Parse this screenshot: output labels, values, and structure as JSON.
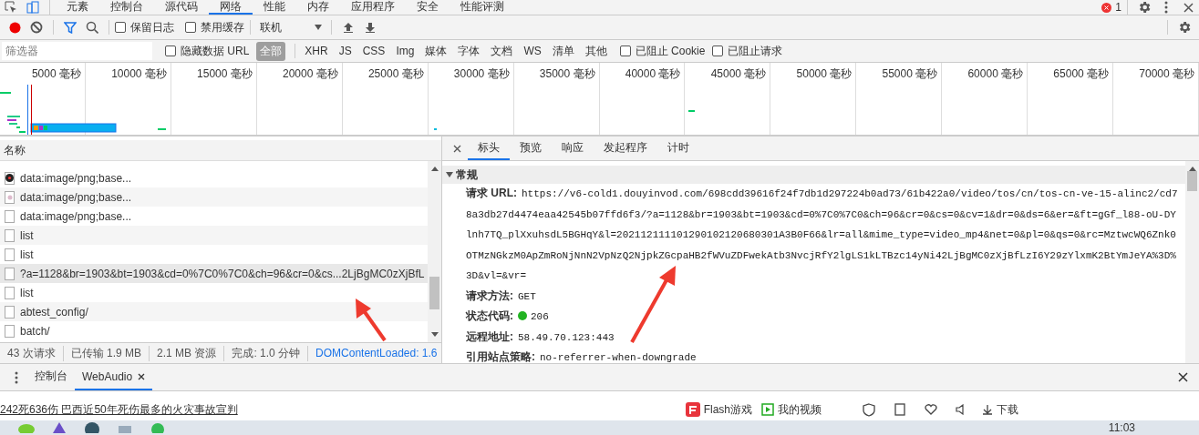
{
  "devtools_tabs": [
    {
      "label": "元素",
      "selected": false
    },
    {
      "label": "控制台",
      "selected": false
    },
    {
      "label": "源代码",
      "selected": false
    },
    {
      "label": "网络",
      "selected": true
    },
    {
      "label": "性能",
      "selected": false
    },
    {
      "label": "内存",
      "selected": false
    },
    {
      "label": "应用程序",
      "selected": false
    },
    {
      "label": "安全",
      "selected": false
    },
    {
      "label": "性能评测",
      "selected": false
    }
  ],
  "error_count": "1",
  "toolbar": {
    "recording": true,
    "preserve_log": {
      "label": "保留日志",
      "checked": false
    },
    "disable_cache": {
      "label": "禁用缓存",
      "checked": false
    },
    "throttling": "联机"
  },
  "filter": {
    "placeholder": "筛选器",
    "hide_data_urls": {
      "label": "隐藏数据 URL",
      "checked": false
    },
    "types": [
      {
        "label": "全部",
        "selected": true
      },
      {
        "label": "XHR",
        "selected": false
      },
      {
        "label": "JS",
        "selected": false
      },
      {
        "label": "CSS",
        "selected": false
      },
      {
        "label": "Img",
        "selected": false
      },
      {
        "label": "媒体",
        "selected": false
      },
      {
        "label": "字体",
        "selected": false
      },
      {
        "label": "文档",
        "selected": false
      },
      {
        "label": "WS",
        "selected": false
      },
      {
        "label": "清单",
        "selected": false
      },
      {
        "label": "其他",
        "selected": false
      }
    ],
    "blocked_cookies": {
      "label": "已阻止 Cookie",
      "checked": false
    },
    "blocked_requests": {
      "label": "已阻止请求",
      "checked": false
    }
  },
  "timeline": {
    "ticks": [
      "5000 毫秒",
      "10000 毫秒",
      "15000 毫秒",
      "20000 毫秒",
      "25000 毫秒",
      "30000 毫秒",
      "35000 毫秒",
      "40000 毫秒",
      "45000 毫秒",
      "50000 毫秒",
      "55000 毫秒",
      "60000 毫秒",
      "65000 毫秒",
      "70000 毫秒"
    ]
  },
  "requests": {
    "header": "名称",
    "rows": [
      {
        "name": "data:image/png;base...",
        "kind": "logo",
        "selected": false
      },
      {
        "name": "data:image/png;base...",
        "kind": "image",
        "selected": false
      },
      {
        "name": "data:image/png;base...",
        "kind": "blank",
        "selected": false
      },
      {
        "name": "list",
        "kind": "blank",
        "selected": false
      },
      {
        "name": "list",
        "kind": "blank",
        "selected": false
      },
      {
        "name": "?a=1128&br=1903&bt=1903&cd=0%7C0%7C0&ch=96&cr=0&cs...2LjBgMC0zXjBfL",
        "kind": "blank",
        "selected": true
      },
      {
        "name": "list",
        "kind": "blank",
        "selected": false
      },
      {
        "name": "abtest_config/",
        "kind": "blank",
        "selected": false
      },
      {
        "name": "batch/",
        "kind": "blank",
        "selected": false
      }
    ]
  },
  "summary": [
    {
      "text": "43 次请求",
      "kind": "plain"
    },
    {
      "text": "已传输 1.9 MB",
      "kind": "plain"
    },
    {
      "text": "2.1 MB 资源",
      "kind": "plain"
    },
    {
      "text": "完成: 1.0 分钟",
      "kind": "plain"
    },
    {
      "text": "DOMContentLoaded: 1.6",
      "kind": "link"
    }
  ],
  "detail": {
    "tabs": [
      {
        "label": "标头",
        "selected": true
      },
      {
        "label": "预览",
        "selected": false
      },
      {
        "label": "响应",
        "selected": false
      },
      {
        "label": "发起程序",
        "selected": false
      },
      {
        "label": "计时",
        "selected": false
      }
    ],
    "section": {
      "title": "常规",
      "expanded": true
    },
    "fields": [
      {
        "label": "请求 URL:",
        "value": "https://v6-cold1.douyinvod.com/698cdd39616f24f7db1d297224b0ad73/61b422a0/video/tos/cn/tos-cn-ve-15-alinc2/cd78a3db27d4474eaa42545b07ffd6f3/?a=1128&br=1903&bt=1903&cd=0%7C0%7C0&ch=96&cr=0&cs=0&cv=1&dr=0&ds=6&er=&ft=gGf_l88-oU-DYlnh7TQ_plXxuhsdL5BGHqY&l=202112111101290102120680301A3B0F66&lr=all&mime_type=video_mp4&net=0&pl=0&qs=0&rc=MztwcWQ6Znk0OTMzNGkzM0ApZmRoNjNnN2VpNzQ2NjpkZGcpaHB2fWVuZDFwekAtb3NvcjRfY2lgLS1kLTBzc14yNi42LjBgMC0zXjBfLzI6Y29zYlxmK2BtYmJeYA%3D%3D&vl=&vr="
      },
      {
        "label": "请求方法:",
        "value": "GET"
      },
      {
        "label": "状态代码:",
        "value": "206",
        "color": "#22b322"
      },
      {
        "label": "远程地址:",
        "value": "58.49.70.123:443"
      },
      {
        "label": "引用站点策略:",
        "value": "no-referrer-when-downgrade"
      }
    ]
  },
  "drawer": {
    "tabs": [
      {
        "label": "控制台",
        "selected": false,
        "closable": false
      },
      {
        "label": "WebAudio",
        "selected": true,
        "closable": true
      }
    ]
  },
  "browser_bar": {
    "news": "242死636伤 巴西近50年死伤最多的火灾事故宣判",
    "flash": "Flash游戏",
    "videos": "我的视频",
    "download": "下载"
  },
  "taskbar": {
    "time": "11:03"
  }
}
